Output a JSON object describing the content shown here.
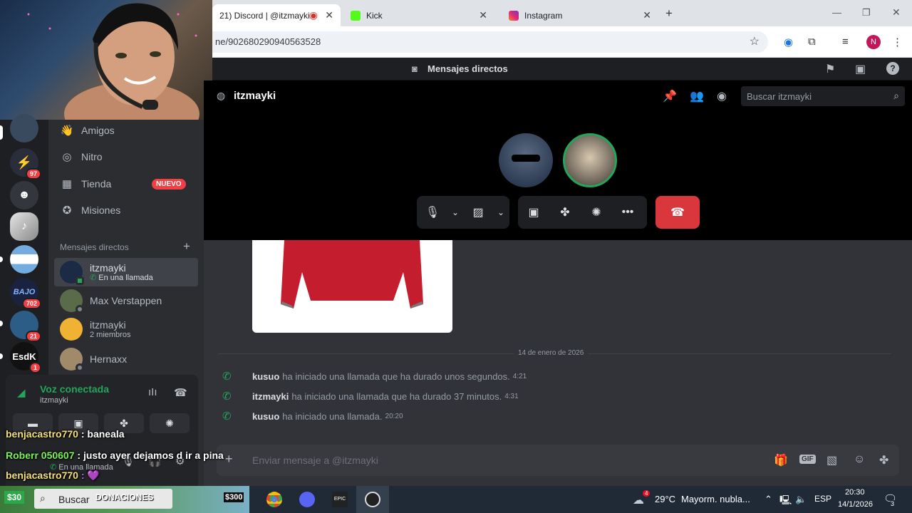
{
  "browser": {
    "tabs": [
      {
        "label": "21) Discord | @itzmayki"
      },
      {
        "label": "Kick"
      },
      {
        "label": "Instagram"
      }
    ],
    "url": "ne/902680290940563528",
    "profile_initial": "N",
    "colors": {
      "tab_bar": "#dfe3e8",
      "profile": "#c2185b"
    }
  },
  "discord": {
    "topbar_title": "Mensajes directos",
    "servers": [
      {
        "badge": ""
      },
      {
        "badge": "97"
      },
      {
        "badge": ""
      },
      {
        "badge": ""
      },
      {
        "badge": ""
      },
      {
        "badge": "702",
        "label": "BAJO"
      },
      {
        "badge": "21"
      },
      {
        "badge": "1",
        "label": "EsdK"
      }
    ],
    "nav": {
      "friends": "Amigos",
      "nitro": "Nitro",
      "shop": "Tienda",
      "shop_badge": "NUEVO",
      "missions": "Misiones"
    },
    "dm_header": "Mensajes directos",
    "dms": [
      {
        "name": "itzmayki",
        "sub": "En una llamada"
      },
      {
        "name": "Max Verstappen",
        "sub": ""
      },
      {
        "name": "itzmayki",
        "sub": "2 miembros"
      },
      {
        "name": "Hernaxx",
        "sub": ""
      }
    ],
    "voice": {
      "status": "Voz conectada",
      "channel": "itzmayki"
    },
    "user_panel_status": "En una llamada",
    "channel_title": "itzmayki",
    "search_placeholder": "Buscar itzmayki",
    "date_divider": "14 de enero de 2026",
    "messages": [
      {
        "user": "kusuo",
        "text": "ha iniciado una llamada que ha durado unos segundos.",
        "time": "4:21"
      },
      {
        "user": "itzmayki",
        "text": "ha iniciado una llamada que ha durado 37 minutos.",
        "time": "4:31"
      },
      {
        "user": "kusuo",
        "text": "ha iniciado una llamada.",
        "time": "20:20"
      }
    ],
    "composer_placeholder": "Enviar mensaje a @itzmayki",
    "colors": {
      "accent": "#5865f2",
      "green": "#23a55a",
      "hangup": "#da373c",
      "badge_red": "#f23f43"
    }
  },
  "stream_overlay": {
    "chat": [
      {
        "user": "benjacastro770",
        "text": " : baneala"
      },
      {
        "user": "Roberr 050607",
        "text": " : justo ayer dejamos d ir a pina"
      },
      {
        "user": "benjacastro770",
        "text": " : 💜"
      }
    ],
    "donate_left": "$30",
    "donate_label": "DONACIONES",
    "donate_right": "$300"
  },
  "taskbar": {
    "search": "Buscar",
    "weather_temp": "29°C",
    "weather_text": "Mayorm. nubla...",
    "weather_badge": "4",
    "lang": "ESP",
    "time": "20:30",
    "date": "14/1/2026",
    "notif": "3"
  }
}
